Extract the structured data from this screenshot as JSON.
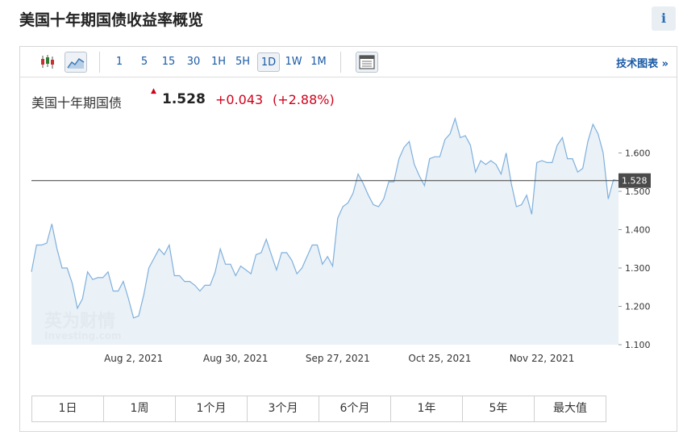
{
  "page": {
    "title": "美国十年期国债收益率概览",
    "info_label": "i"
  },
  "toolbar": {
    "timeframes": [
      "1",
      "5",
      "15",
      "30",
      "1H",
      "5H",
      "1D",
      "1W",
      "1M"
    ],
    "active_timeframe": "1D",
    "tech_chart_label": "技术图表 »"
  },
  "quote": {
    "name": "美国十年期国债",
    "arrow": "▲",
    "price": "1.528",
    "change": "+0.043",
    "change_pct": "(+2.88%)"
  },
  "colors": {
    "line": "#7fb0dc",
    "area": "#e6eef6",
    "up": "#d0021b",
    "link": "#1a5aa6",
    "tag": "#4a4a4a"
  },
  "watermark": {
    "cn": "英为财情",
    "en": "Investing.com"
  },
  "ranges": [
    "1日",
    "1周",
    "1个月",
    "3个月",
    "6个月",
    "1年",
    "5年",
    "最大值"
  ],
  "chart_data": {
    "type": "area",
    "title": "",
    "xlabel": "",
    "ylabel": "",
    "ylim": [
      1.1,
      1.7
    ],
    "yticks": [
      "1.100",
      "1.200",
      "1.300",
      "1.400",
      "1.500",
      "1.600"
    ],
    "xticks": [
      {
        "label": "Aug 2, 2021",
        "index": 20
      },
      {
        "label": "Aug 30, 2021",
        "index": 40
      },
      {
        "label": "Sep 27, 2021",
        "index": 60
      },
      {
        "label": "Oct 25, 2021",
        "index": 80
      },
      {
        "label": "Nov 22, 2021",
        "index": 100
      }
    ],
    "last_value": 1.528,
    "last_label": "1.528",
    "values": [
      1.29,
      1.36,
      1.36,
      1.365,
      1.415,
      1.35,
      1.3,
      1.3,
      1.26,
      1.195,
      1.22,
      1.29,
      1.27,
      1.275,
      1.275,
      1.29,
      1.24,
      1.24,
      1.265,
      1.22,
      1.17,
      1.175,
      1.23,
      1.3,
      1.325,
      1.35,
      1.335,
      1.36,
      1.28,
      1.28,
      1.265,
      1.265,
      1.255,
      1.24,
      1.255,
      1.255,
      1.29,
      1.35,
      1.31,
      1.31,
      1.28,
      1.305,
      1.295,
      1.285,
      1.335,
      1.34,
      1.375,
      1.335,
      1.295,
      1.34,
      1.34,
      1.32,
      1.285,
      1.3,
      1.33,
      1.36,
      1.36,
      1.31,
      1.33,
      1.305,
      1.43,
      1.46,
      1.47,
      1.495,
      1.545,
      1.52,
      1.49,
      1.465,
      1.46,
      1.48,
      1.525,
      1.525,
      1.585,
      1.615,
      1.63,
      1.57,
      1.54,
      1.515,
      1.585,
      1.59,
      1.59,
      1.635,
      1.65,
      1.69,
      1.64,
      1.645,
      1.62,
      1.55,
      1.58,
      1.57,
      1.58,
      1.57,
      1.545,
      1.6,
      1.52,
      1.46,
      1.465,
      1.49,
      1.44,
      1.575,
      1.58,
      1.575,
      1.575,
      1.62,
      1.64,
      1.585,
      1.585,
      1.55,
      1.56,
      1.63,
      1.675,
      1.65,
      1.6,
      1.48,
      1.53,
      1.528
    ]
  }
}
